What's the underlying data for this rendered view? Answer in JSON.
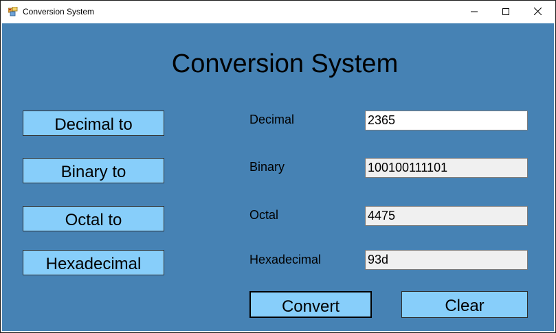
{
  "window": {
    "title": "Conversion System",
    "icon": "app-window-icon",
    "controls": {
      "minimize": "minimize-icon",
      "maximize": "maximize-icon",
      "close": "close-icon"
    }
  },
  "main": {
    "heading": "Conversion System",
    "side_buttons": [
      {
        "label": "Decimal to"
      },
      {
        "label": "Binary to"
      },
      {
        "label": "Octal to"
      },
      {
        "label": "Hexadecimal"
      }
    ],
    "fields": [
      {
        "label": "Decimal",
        "value": "2365",
        "editable": true
      },
      {
        "label": "Binary",
        "value": "100100111101",
        "editable": false
      },
      {
        "label": "Octal",
        "value": "4475",
        "editable": false
      },
      {
        "label": "Hexadecimal",
        "value": "93d",
        "editable": false
      }
    ],
    "convert_label": "Convert",
    "clear_label": "Clear"
  },
  "colors": {
    "client_background": "#4682b4",
    "button_background": "#87cefa",
    "readonly_field": "#f0f0f0",
    "editable_field": "#ffffff"
  }
}
